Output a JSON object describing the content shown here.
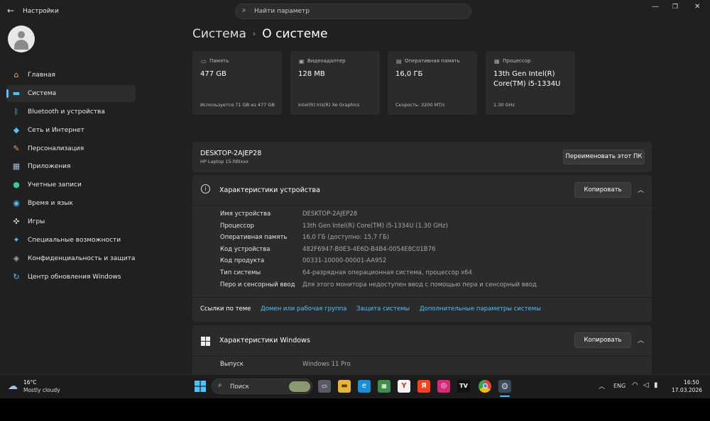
{
  "window": {
    "title": "Настройки",
    "search_placeholder": "Найти параметр"
  },
  "sidebar": {
    "items": [
      {
        "label": "Главная",
        "icon": "home-icon",
        "color": "#e8a87c"
      },
      {
        "label": "Система",
        "icon": "monitor-icon",
        "color": "#4cc2ff",
        "selected": true
      },
      {
        "label": "Bluetooth и устройства",
        "icon": "bluetooth-icon",
        "color": "#4cc2ff"
      },
      {
        "label": "Сеть и Интернет",
        "icon": "wifi-icon",
        "color": "#4cc2ff"
      },
      {
        "label": "Персонализация",
        "icon": "brush-icon",
        "color": "#e8a060"
      },
      {
        "label": "Приложения",
        "icon": "apps-icon",
        "color": "#a0b8d8"
      },
      {
        "label": "Учетные записи",
        "icon": "person-icon",
        "color": "#3ec99b"
      },
      {
        "label": "Время и язык",
        "icon": "globe-clock-icon",
        "color": "#4cc2ff"
      },
      {
        "label": "Игры",
        "icon": "gamepad-icon",
        "color": "#c0c0c0"
      },
      {
        "label": "Специальные возможности",
        "icon": "accessibility-icon",
        "color": "#4cc2ff"
      },
      {
        "label": "Конфиденциальность и защита",
        "icon": "shield-icon",
        "color": "#9aa8b8"
      },
      {
        "label": "Центр обновления Windows",
        "icon": "update-icon",
        "color": "#4cc2ff"
      }
    ]
  },
  "breadcrumb": {
    "parent": "Система",
    "separator": "›",
    "current": "О системе"
  },
  "cards": [
    {
      "label": "Память",
      "value": "477 GB",
      "detail": "Используется 71 GB из 477 GB",
      "icon": "storage-icon"
    },
    {
      "label": "Видеоадаптер",
      "value": "128 MB",
      "detail": "Intel(R) Iris(R) Xe Graphics",
      "icon": "gpu-icon"
    },
    {
      "label": "Оперативная память",
      "value": "16,0 ГБ",
      "detail": "Скорость: 3200 MT/с",
      "icon": "ram-icon"
    },
    {
      "label": "Процессор",
      "value": "13th Gen Intel(R) Core(TM) i5-1334U",
      "detail": "1.30 GHz",
      "icon": "cpu-icon"
    }
  ],
  "device": {
    "name": "DESKTOP-2AJEP28",
    "model": "HP Laptop 15-fd0xxx",
    "rename_label": "Переименовать этот ПК"
  },
  "device_specs": {
    "title": "Характеристики устройства",
    "copy_label": "Копировать",
    "rows": [
      {
        "key": "Имя устройства",
        "value": "DESKTOP-2AJEP28"
      },
      {
        "key": "Процессор",
        "value": "13th Gen Intel(R) Core(TM) i5-1334U (1.30 GHz)"
      },
      {
        "key": "Оперативная память",
        "value": "16,0 ГБ (доступно: 15,7 ГБ)"
      },
      {
        "key": "Код устройства",
        "value": "482F6947-B0E3-4E6D-B4B4-0054E8C01B76"
      },
      {
        "key": "Код продукта",
        "value": "00331-10000-00001-AA952"
      },
      {
        "key": "Тип системы",
        "value": "64-разрядная операционная система, процессор x64"
      },
      {
        "key": "Перо и сенсорный ввод",
        "value": "Для этого монитора недоступен ввод с помощью пера и сенсорный ввод"
      }
    ]
  },
  "related_links": {
    "label": "Ссылки по теме",
    "links": [
      "Домен или рабочая группа",
      "Защита системы",
      "Дополнительные параметры системы"
    ]
  },
  "windows_specs": {
    "title": "Характеристики Windows",
    "copy_label": "Копировать",
    "rows": [
      {
        "key": "Выпуск",
        "value": "Windows 11 Pro"
      }
    ]
  },
  "taskbar": {
    "weather_temp": "16°C",
    "weather_desc": "Mostly cloudy",
    "search_label": "Поиск",
    "lang": "ENG",
    "time": "16:50",
    "date": "17.03.2026"
  }
}
